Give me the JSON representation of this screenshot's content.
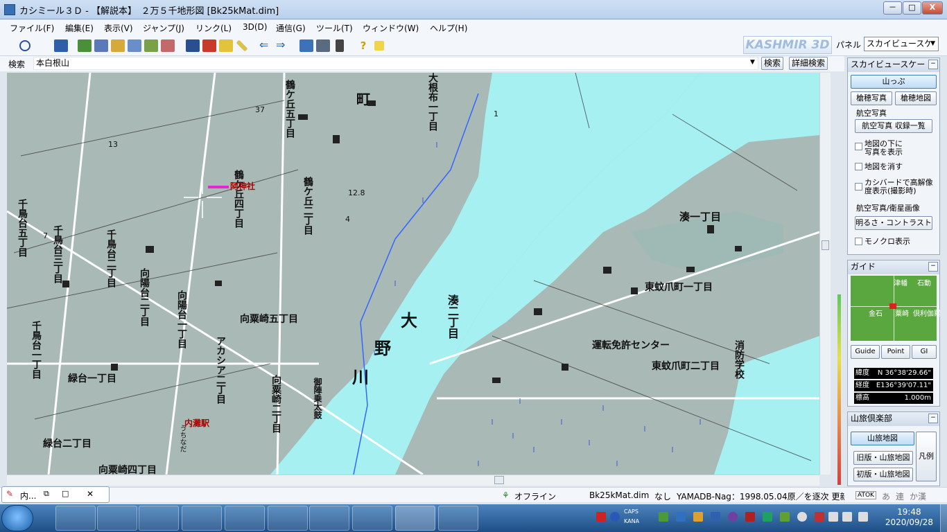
{
  "window": {
    "title": "カシミール３Ｄ - 【解説本】　２万５千地形図 [Bk25kMat.dim]",
    "buttons": [
      "－",
      "□",
      "X"
    ]
  },
  "menu": [
    "ファイル(F)",
    "編集(E)",
    "表示(V)",
    "ジャンプ(J)",
    "リンク(L)",
    "3D(D)",
    "通信(G)",
    "ツール(T)",
    "ウィンドウ(W)",
    "ヘルプ(H)"
  ],
  "toolbar": {
    "logo": "KASHMIR 3D",
    "panel_label": "パネル",
    "panel_select": "スカイビュースケ"
  },
  "search": {
    "label": "検索",
    "value": "本白根山",
    "search_button": "検索",
    "detail_button": "詳細検索"
  },
  "map": {
    "labels": [
      "千鳥台五丁目",
      "千鳥台三丁目",
      "千鳥台二丁目",
      "千鳥台一丁目",
      "向陽台二丁目",
      "向陽台一丁目",
      "鶴ケ丘五丁目",
      "鶴ケ丘四丁目",
      "鶴ケ丘二丁目",
      "向粟崎五丁目",
      "アカシア二丁目",
      "向粟崎二丁目",
      "緑台一丁目",
      "緑台二丁目",
      "向粟崎四丁目",
      "大根布一丁目",
      "町",
      "湊二丁目",
      "湊一丁目",
      "東蚊爪町一丁目",
      "東蚊爪町二丁目",
      "運転免許センター",
      "消防学校",
      "大",
      "野",
      "川",
      "御陣乗太鼓"
    ],
    "red_labels": [
      "阿神社",
      "内灘駅",
      "うちなだ"
    ],
    "numbers": [
      "37",
      "13",
      "12.8",
      "7",
      "4",
      "1"
    ]
  },
  "right_panel": {
    "skyview": {
      "title": "スカイビュースケー",
      "btn_yamappu": "山っぷ",
      "btn_photo": "槍穂写真",
      "btn_map": "槍穂地図",
      "aerial_label": "航空写真",
      "aerial_list": "航空写真 収録一覧",
      "chk1": "地図の下に\n写真を表示",
      "chk2": "地図を消す",
      "chk3": "カシバードで高解像\n度表示(撮影時)",
      "aerial_sat": "航空写真/衛星画像",
      "brightness": "明るさ・コントラスト",
      "chk4": "モノクロ表示"
    },
    "guide": {
      "title": "ガイド",
      "places": [
        "津幡",
        "石動",
        "金石",
        "粟崎",
        "倶利伽羅"
      ],
      "tabs": [
        "Guide",
        "Point",
        "GI"
      ],
      "lat_label": "緯度",
      "lat_value": "N 36°38'29.66\"",
      "lon_label": "経度",
      "lon_value": "E136°39'07.11\"",
      "alt_label": "標高",
      "alt_value": "1.000m"
    },
    "sanryo": {
      "title": "山旅倶楽部",
      "btn_map": "山旅地図",
      "btn_old": "旧版・山旅地図",
      "btn_first": "初版・山旅地図",
      "legend": "凡例"
    }
  },
  "status": {
    "mini_window": "内...",
    "offline": "オフライン",
    "file": "Bk25kMat.dim",
    "none": "なし",
    "info": "YAMADB-Nag：1998.05.04原／を逐次 更新",
    "ime": [
      "ATOK",
      "あ",
      "連",
      "か漢"
    ]
  },
  "taskbar": {
    "time": "19:48",
    "date": "2020/09/28",
    "caps": "CAPS",
    "kana": "KANA"
  }
}
